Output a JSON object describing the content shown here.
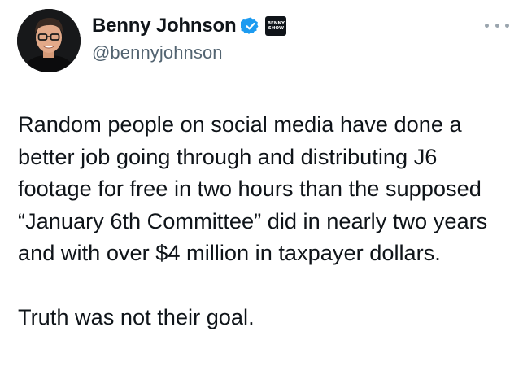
{
  "author": {
    "display_name": "Benny Johnson",
    "handle": "@bennyjohnson",
    "verified": true,
    "affiliate_badge": "BENNY SHOW",
    "avatar_icon": "person-avatar",
    "more_icon": "more-horizontal-icon"
  },
  "tweet": {
    "text": "Random people on social media have done a better job going through and distributing J6 footage for free in two hours than the supposed “January 6th Committee” did in nearly two years and with over $4 million in taxpayer dollars.\n\nTruth was not their goal."
  },
  "colors": {
    "text": "#0f1419",
    "secondary_text": "#536471",
    "verified_blue": "#1d9bf0",
    "background": "#ffffff"
  }
}
